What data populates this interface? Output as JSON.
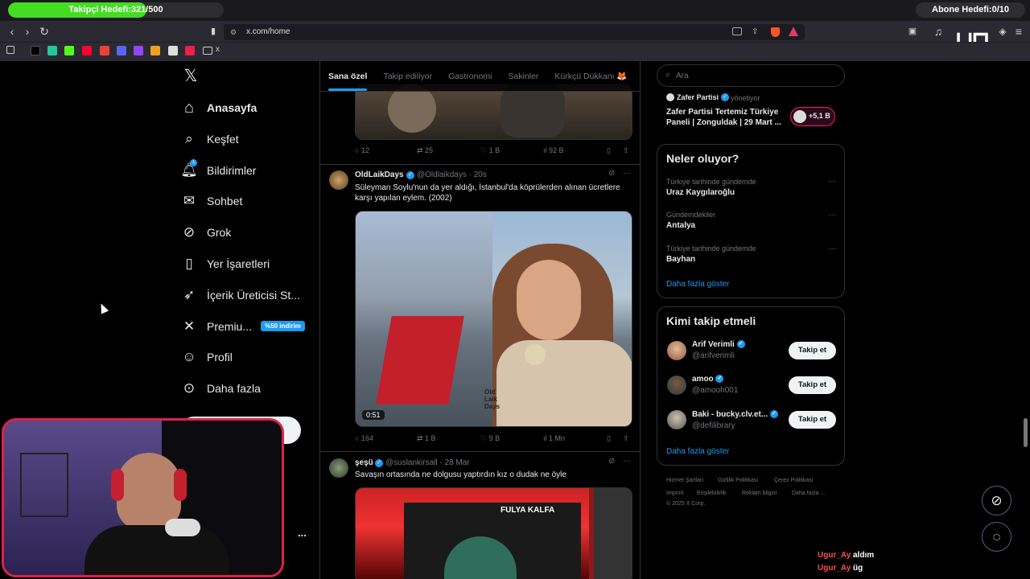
{
  "overlay": {
    "follow_goal": "Takipçi Hedefi:321/500",
    "follow_goal_progress": 0.642,
    "sub_goal": "Abone Hedefi:0/10",
    "chat": [
      {
        "user": "Ugur_Ay",
        "msg": "aldım"
      },
      {
        "user": "Ugur_Ay",
        "msg": "üg"
      }
    ]
  },
  "browser": {
    "url": "x.com/home",
    "bookmark_more": "x"
  },
  "nav": {
    "items": [
      {
        "label": "Anasayfa",
        "icon": "home-icon"
      },
      {
        "label": "Keşfet",
        "icon": "search-icon"
      },
      {
        "label": "Bildirimler",
        "icon": "bell-icon",
        "badge": "1"
      },
      {
        "label": "Sohbet",
        "icon": "mail-icon"
      },
      {
        "label": "Grok",
        "icon": "grok-icon"
      },
      {
        "label": "Yer İşaretleri",
        "icon": "bookmark-icon"
      },
      {
        "label": "İçerik Üreticisi St...",
        "icon": "rocket-icon"
      },
      {
        "label": "Premiu...",
        "icon": "x-logo-icon",
        "badge": "%50 indirim"
      },
      {
        "label": "Profil",
        "icon": "user-icon"
      },
      {
        "label": "Daha fazla",
        "icon": "more-circle-icon"
      }
    ],
    "more_dots": "..."
  },
  "feed": {
    "tabs": [
      "Sana özel",
      "Takip ediliyor",
      "Gastronomi",
      "Sakinler",
      "Kürkçü Dükkanı 🦊"
    ],
    "active_tab": 0,
    "post0_actions": {
      "replies": "12",
      "reposts": "25",
      "likes": "1 B",
      "views": "92 B"
    },
    "post1": {
      "name": "OldLaikDays",
      "handle": "@Oldlaikdays · 20s",
      "text": "Süleyman Soylu'nun da yer aldığı, İstanbul'da köprülerden alınan ücretlere karşı yapılan eylem. (2002)",
      "duration": "0:51",
      "watermark": "Old Laik Days",
      "replies": "164",
      "reposts": "1 B",
      "likes": "9 B",
      "views": "1 Mn"
    },
    "post2": {
      "name": "şeşü",
      "handle": "@suslankirsall · 28 Mar",
      "text": "Savaşın ortasında ne dolgusu yaptırdın kız o dudak ne öyle",
      "overlay_text": "FULYA KALFA"
    }
  },
  "right": {
    "search_placeholder": "Ara",
    "space": {
      "host": "Zafer Partisi",
      "role": "yönetiyor",
      "title": "Zafer Partisi Tertemiz Türkiye Paneli | Zonguldak | 29 Mart ...",
      "listeners": "+5,1 B"
    },
    "trends_title": "Neler oluyor?",
    "trends": [
      {
        "category": "Türkiye tarihinde gündemde",
        "name": "Uraz Kaygılaroğlu"
      },
      {
        "category": "Gündemdekiler",
        "name": "Antalya"
      },
      {
        "category": "Türkiye tarihinde gündemde",
        "name": "Bayhan"
      }
    ],
    "trends_more": "Daha fazla göster",
    "who_title": "Kimi takip etmeli",
    "who": [
      {
        "name": "Arif Verimli",
        "handle": "@arifverimli",
        "button": "Takip et"
      },
      {
        "name": "amoo",
        "handle": "@amooh001",
        "button": "Takip et"
      },
      {
        "name": "Baki - bucky.clv.et...",
        "handle": "@defilibrary",
        "button": "Takip et"
      }
    ],
    "who_more": "Daha fazla göster",
    "footer": [
      "Hizmet Şartları",
      "Gizlilik Politikası",
      "Çerez Politikası",
      "Imprint",
      "Erişilebilirlik",
      "Reklam bilgisi",
      "Daha fazla ...",
      "© 2025 X Corp."
    ],
    "trend_more_icon": "···"
  },
  "colors": {
    "accent": "#1d9bf0",
    "goal_fill": "#44dd22",
    "webcam_border": "#e0204a"
  }
}
